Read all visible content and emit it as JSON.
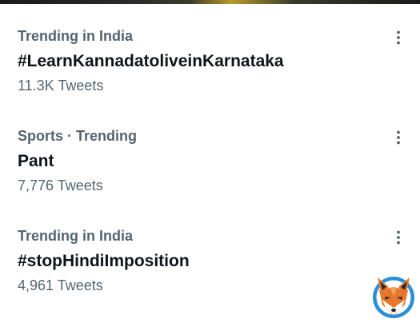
{
  "trends": [
    {
      "context": "Trending in India",
      "name": "#LearnKannadatoliveinKarnataka",
      "count": "11.3K Tweets",
      "more_icon": "more-vertical-icon"
    },
    {
      "context": "Sports · Trending",
      "name": "Pant",
      "count": "7,776 Tweets",
      "more_icon": "more-vertical-icon"
    },
    {
      "context": "Trending in India",
      "name": "#stopHindiImposition",
      "count": "4,961 Tweets",
      "more_icon": "more-vertical-icon"
    }
  ],
  "colors": {
    "primary_text": "#0f1419",
    "secondary_text": "#536471",
    "background": "#ffffff",
    "logo_blue": "#2a8fd6",
    "logo_orange": "#e8772e"
  },
  "logo": {
    "icon": "fox-logo-icon"
  }
}
